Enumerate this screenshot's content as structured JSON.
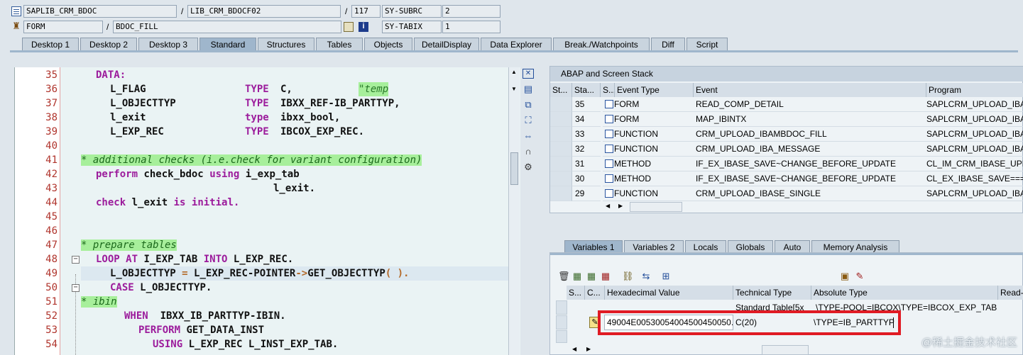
{
  "header": {
    "row1": {
      "program": "SAPLIB_CRM_BDOC",
      "include": "LIB_CRM_BDOCF02",
      "line": "117",
      "sysvar": "SY-SUBRC",
      "sysval": "2"
    },
    "row2": {
      "type": "FORM",
      "name": "BDOC_FILL",
      "sysvar": "SY-TABIX",
      "sysval": "1"
    },
    "slash": "/"
  },
  "tabs": [
    "Desktop 1",
    "Desktop 2",
    "Desktop 3",
    "Standard",
    "Structures",
    "Tables",
    "Objects",
    "DetailDisplay",
    "Data Explorer",
    "Break./Watchpoints",
    "Diff",
    "Script"
  ],
  "active_tab": "Standard",
  "code": {
    "line_numbers": [
      "35",
      "36",
      "37",
      "38",
      "39",
      "40",
      "41",
      "42",
      "43",
      "44",
      "45",
      "46",
      "47",
      "48",
      "49",
      "50",
      "51",
      "52",
      "53",
      "54"
    ],
    "l35": "DATA:",
    "l36a": "L_FLAG",
    "l36b": "TYPE",
    "l36c": "C,",
    "l36d": "\"temp",
    "l37a": "L_OBJECTTYP",
    "l37b": "TYPE",
    "l37c": "IBXX_REF-IB_PARTTYP,",
    "l38a": "l_exit",
    "l38b": "type",
    "l38c": "ibxx_bool,",
    "l39a": "L_EXP_REC",
    "l39b": "TYPE",
    "l39c": "IBCOX_EXP_REC.",
    "l41": "* additional checks (i.e.check for variant configuration)",
    "l42a": "perform",
    "l42b": "check_bdoc",
    "l42c": "using",
    "l42d": "i_exp_tab",
    "l43": "l_exit.",
    "l44a": "check",
    "l44b": "l_exit",
    "l44c": "is initial.",
    "l47": "* prepare tables",
    "l48a": "LOOP",
    "l48b": "AT",
    "l48c": "I_EXP_TAB",
    "l48d": "INTO",
    "l48e": "L_EXP_REC.",
    "l49a": "L_OBJECTTYP",
    "l49b": "=",
    "l49c": "L_EXP_REC-POINTER",
    "l49d": "->",
    "l49e": "GET_OBJECTTYP",
    "l49f": "( ).",
    "l50a": "CASE",
    "l50b": "L_OBJECTTYP.",
    "l51": "* ibin",
    "l52a": "WHEN",
    "l52b": "IBXX_IB_PARTTYP-IBIN.",
    "l53a": "PERFORM",
    "l53b": "GET_DATA_INST",
    "l54a": "USING",
    "l54b": "L_EXP_REC L_INST_EXP_TAB."
  },
  "stack": {
    "title": "ABAP and Screen Stack",
    "columns": [
      "St...",
      "Sta...",
      "S...",
      "Event Type",
      "Event",
      "Program"
    ],
    "rows": [
      {
        "level": "35",
        "type": "FORM",
        "event": "READ_COMP_DETAIL",
        "program": "SAPLCRM_UPLOAD_IBASE"
      },
      {
        "level": "34",
        "type": "FORM",
        "event": "MAP_IBINTX",
        "program": "SAPLCRM_UPLOAD_IBASE"
      },
      {
        "level": "33",
        "type": "FUNCTION",
        "event": "CRM_UPLOAD_IBAMBDOC_FILL",
        "program": "SAPLCRM_UPLOAD_IBASE"
      },
      {
        "level": "32",
        "type": "FUNCTION",
        "event": "CRM_UPLOAD_IBA_MESSAGE",
        "program": "SAPLCRM_UPLOAD_IBASE"
      },
      {
        "level": "31",
        "type": "METHOD",
        "event": "IF_EX_IBASE_SAVE~CHANGE_BEFORE_UPDATE",
        "program": "CL_IM_CRM_IBASE_UPL"
      },
      {
        "level": "30",
        "type": "METHOD",
        "event": "IF_EX_IBASE_SAVE~CHANGE_BEFORE_UPDATE",
        "program": "CL_EX_IBASE_SAVE===="
      },
      {
        "level": "29",
        "type": "FUNCTION",
        "event": "CRM_UPLOAD_IBASE_SINGLE",
        "program": "SAPLCRM_UPLOAD_IBASE"
      }
    ]
  },
  "vartabs": [
    "Variables 1",
    "Variables 2",
    "Locals",
    "Globals",
    "Auto",
    "Memory Analysis"
  ],
  "active_vartab": "Variables 1",
  "vars": {
    "columns": [
      "S...",
      "C...",
      "Hexadecimal Value",
      "Technical Type",
      "Absolute Type",
      "Read-"
    ],
    "row1": {
      "tech": "Standard Table[5x",
      "abs": "\\TYPE-POOL=IBCOX\\TYPE=IBCOX_EXP_TAB"
    },
    "row2": {
      "hex": "49004E00530054004500450050...",
      "tech": "C(20)",
      "abs": "\\TYPE=IB_PARTTYP"
    }
  },
  "watermark": "@稀土掘金技术社区",
  "colors": {
    "highlight_box": "#e01b24",
    "active_tab": "#9fb6cc",
    "comment_bg": "#a7ef9b",
    "keyword": "#9c1c9c"
  }
}
